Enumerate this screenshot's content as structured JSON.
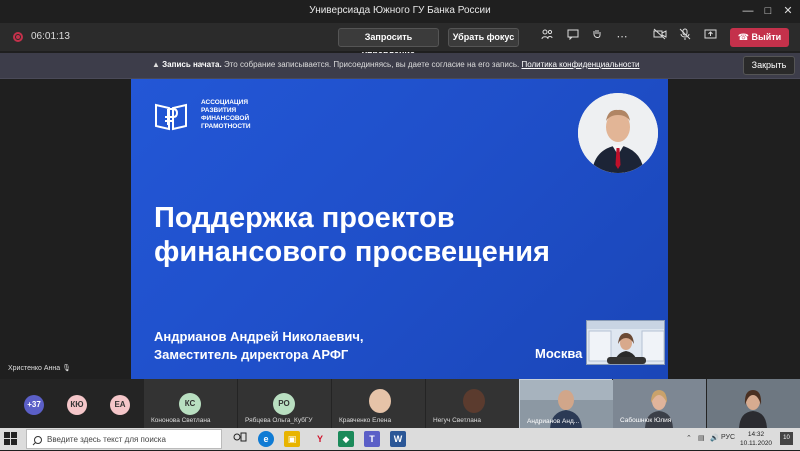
{
  "window": {
    "title": "Универсиада Южного ГУ Банка России"
  },
  "toolbar": {
    "timer": "06:01:13",
    "request_control": "Запросить управление",
    "take_focus": "Убрать фокус",
    "leave": "Выйти"
  },
  "banner": {
    "title": "Запись начата.",
    "text": "Это собрание записывается. Присоединяясь, вы даете согласие на его запись.",
    "link": "Политика конфиденциальности",
    "close": "Закрыть"
  },
  "slide": {
    "logo_line1": "АССОЦИАЦИЯ",
    "logo_line2": "РАЗВИТИЯ",
    "logo_line3": "ФИНАНСОВОЙ",
    "logo_line4": "ГРАМОТНОСТИ",
    "headline_line1": "Поддержка проектов",
    "headline_line2": "финансового просвещения",
    "speaker_name": "Андрианов Андрей Николаевич,",
    "speaker_role": "Заместитель директора АРФГ",
    "city": "Москва"
  },
  "presenter": {
    "name": "Христенко Анна"
  },
  "participants": {
    "more": "+37",
    "p1_initials": "КЮ",
    "p2_initials": "ЕА",
    "tiles": [
      {
        "initials": "КС",
        "name": "Кононова Светлана"
      },
      {
        "initials": "РО",
        "name": "Рябцева Ольга_КубГУ"
      },
      {
        "initials": "",
        "name": "Кравченко Елена"
      },
      {
        "initials": "",
        "name": "Негуч Светлана"
      },
      {
        "initials": "",
        "name": "Андрианов Анд..."
      },
      {
        "initials": "",
        "name": "Сабошнюк Юлия"
      }
    ]
  },
  "taskbar": {
    "search_placeholder": "Введите здесь текст для поиска",
    "lang": "РУС",
    "time": "14:32",
    "date": "10.11.2020",
    "notif_count": "10"
  }
}
